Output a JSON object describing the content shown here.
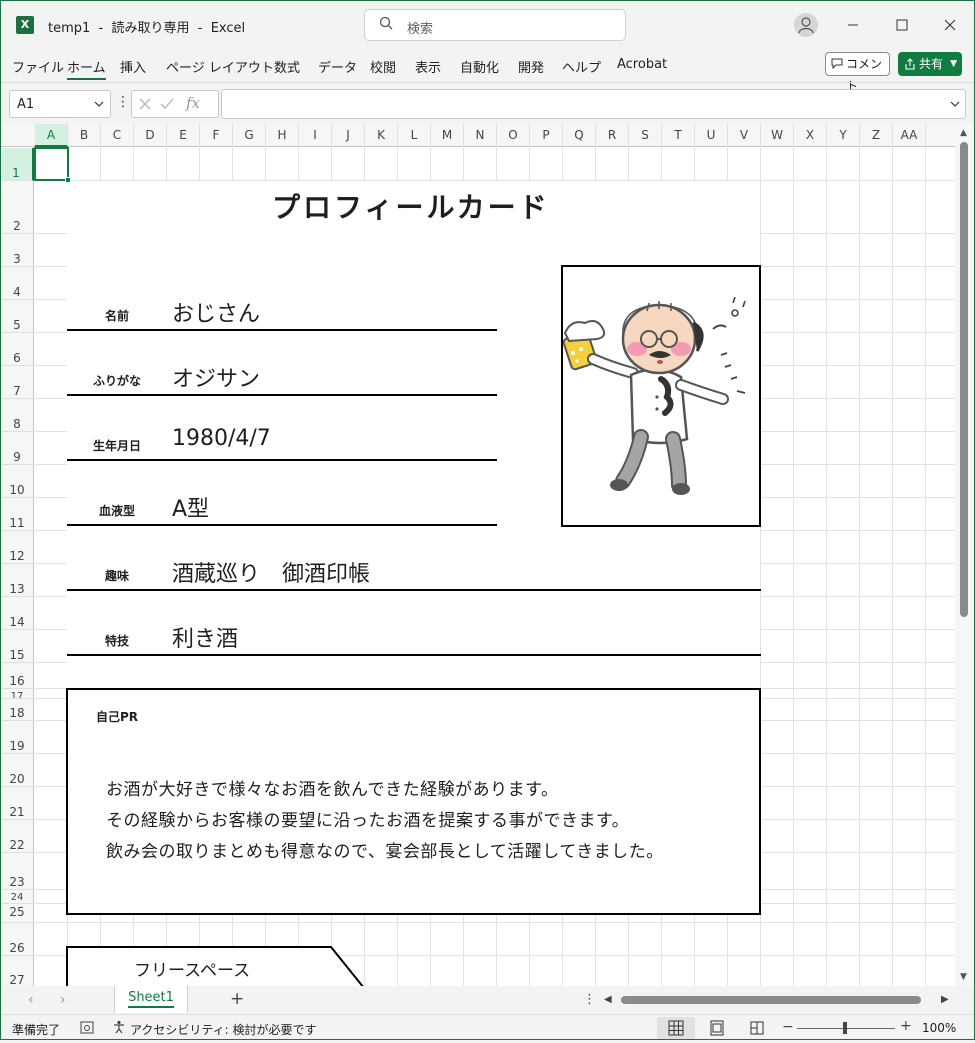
{
  "window": {
    "app_badge": "X",
    "title": "temp1  -  読み取り専用  -  Excel",
    "search_placeholder": "検索"
  },
  "ribbon": {
    "tabs": [
      "ファイル",
      "ホーム",
      "挿入",
      "ページ レイアウト",
      "数式",
      "データ",
      "校閲",
      "表示",
      "自動化",
      "開発",
      "ヘルプ",
      "Acrobat"
    ],
    "active_tab": "ホーム",
    "comment_label": "コメント",
    "share_label": "共有"
  },
  "formula_bar": {
    "name_box": "A1",
    "fx_label": "fx",
    "formula": ""
  },
  "grid": {
    "columns": [
      "A",
      "B",
      "C",
      "D",
      "E",
      "F",
      "G",
      "H",
      "I",
      "J",
      "K",
      "L",
      "M",
      "N",
      "O",
      "P",
      "Q",
      "R",
      "S",
      "T",
      "U",
      "V",
      "W",
      "X",
      "Y",
      "Z",
      "AA"
    ],
    "rows": [
      "1",
      "2",
      "3",
      "4",
      "5",
      "6",
      "7",
      "8",
      "9",
      "10",
      "11",
      "12",
      "13",
      "14",
      "15",
      "16",
      "17",
      "18",
      "19",
      "20",
      "21",
      "22",
      "23",
      "24",
      "25",
      "26",
      "27"
    ],
    "selected_cell": "A1"
  },
  "card": {
    "title": "プロフィールカード",
    "fields": [
      {
        "label": "名前",
        "value": "おじさん"
      },
      {
        "label": "ふりがな",
        "value": "オジサン"
      },
      {
        "label": "生年月日",
        "value": "1980/4/7"
      },
      {
        "label": "血液型",
        "value": "A型"
      },
      {
        "label": "趣味",
        "value": "酒蔵巡り　御酒印帳"
      },
      {
        "label": "特技",
        "value": "利き酒"
      }
    ],
    "pr_label": "自己PR",
    "pr_lines": [
      "お酒が大好きで様々なお酒を飲んできた経験があります。",
      "その経験からお客様の要望に沿ったお酒を提案する事ができます。",
      "飲み会の取りまとめも得意なので、宴会部長として活躍してきました。"
    ],
    "free_space_label": "フリースペース"
  },
  "sheets": {
    "tabs": [
      "Sheet1"
    ],
    "add_label": "+"
  },
  "status": {
    "ready": "準備完了",
    "accessibility": "アクセシビリティ: 検討が必要です",
    "zoom": "100%"
  },
  "colors": {
    "accent": "#107c41",
    "excel_green": "#1d6f42"
  }
}
